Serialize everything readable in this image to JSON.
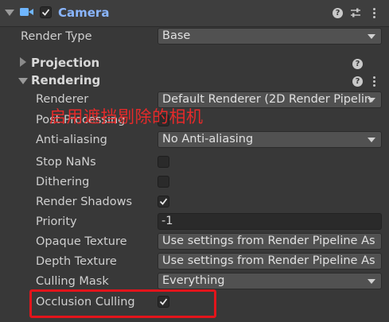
{
  "header": {
    "title": "Camera",
    "enabled": true
  },
  "render_type": {
    "label": "Render Type",
    "value": "Base"
  },
  "sections": {
    "projection": {
      "label": "Projection",
      "expanded": false
    },
    "rendering": {
      "label": "Rendering",
      "expanded": true
    }
  },
  "rendering": {
    "renderer": {
      "label": "Renderer",
      "value": "Default Renderer (2D Render Pipeline"
    },
    "post_processing": {
      "label": "Post Processing",
      "checked": false
    },
    "anti_aliasing": {
      "label": "Anti-aliasing",
      "value": "No Anti-aliasing"
    },
    "stop_nans": {
      "label": "Stop NaNs",
      "checked": false
    },
    "dithering": {
      "label": "Dithering",
      "checked": false
    },
    "render_shadows": {
      "label": "Render Shadows",
      "checked": true
    },
    "priority": {
      "label": "Priority",
      "value": "-1"
    },
    "opaque_texture": {
      "label": "Opaque Texture",
      "value": "Use settings from Render Pipeline As"
    },
    "depth_texture": {
      "label": "Depth Texture",
      "value": "Use settings from Render Pipeline As"
    },
    "culling_mask": {
      "label": "Culling Mask",
      "value": "Everything"
    },
    "occlusion_culling": {
      "label": "Occlusion Culling",
      "checked": true
    }
  },
  "annotation": {
    "text": "启用遮挡剔除的相机",
    "color": "#e52a2a",
    "highlight_color": "#e3141b"
  },
  "icons": {
    "help": "?",
    "component": "camera-icon",
    "presets": "sliders-icon",
    "more": "kebab-icon"
  }
}
